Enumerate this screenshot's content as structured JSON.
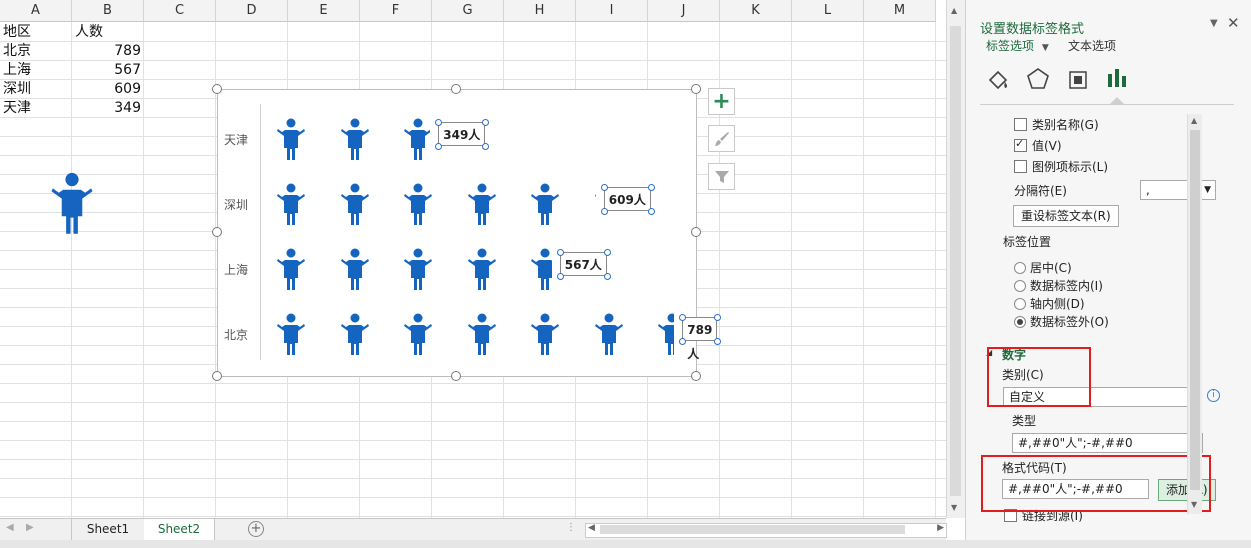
{
  "columns": [
    "A",
    "B",
    "C",
    "D",
    "E",
    "F",
    "G",
    "H",
    "I",
    "J",
    "K",
    "L",
    "M"
  ],
  "table": {
    "header": [
      "地区",
      "人数"
    ],
    "rows": [
      {
        "region": "北京",
        "count": "789"
      },
      {
        "region": "上海",
        "count": "567"
      },
      {
        "region": "深圳",
        "count": "609"
      },
      {
        "region": "天津",
        "count": "349"
      }
    ]
  },
  "chart_data": {
    "type": "bar",
    "orientation": "horizontal",
    "style": "pictograph-person-icons",
    "categories": [
      "天津",
      "深圳",
      "上海",
      "北京"
    ],
    "values": [
      349,
      609,
      567,
      789
    ],
    "data_labels": [
      "349人",
      "609人",
      "567人",
      "789人"
    ],
    "icon_unit": 120,
    "color": "#1565c0",
    "axis_visible": true,
    "grid": false
  },
  "chart_side_buttons": [
    {
      "name": "chart-elements-button",
      "glyph": "+"
    },
    {
      "name": "chart-styles-button",
      "glyph": "✎"
    },
    {
      "name": "chart-filters-button",
      "glyph": "⏷"
    }
  ],
  "sheet_tabs": [
    "Sheet1",
    "Sheet2"
  ],
  "active_tab": "Sheet2",
  "pane": {
    "title": "设置数据标签格式",
    "tab_label_options": "标签选项",
    "tab_text_options": "文本选项",
    "check_category_name": "类别名称(G)",
    "check_value": "值(V)",
    "check_legend_key": "图例项标示(L)",
    "separator_label": "分隔符(E)",
    "separator_value": ",",
    "reset_button": "重设标签文本(R)",
    "position_label": "标签位置",
    "pos_center": "居中(C)",
    "pos_inside_end": "数据标签内(I)",
    "pos_inside_base": "轴内侧(D)",
    "pos_outside_end": "数据标签外(O)",
    "number_section": "数字",
    "category_label": "类别(C)",
    "category_value": "自定义",
    "type_label": "类型",
    "type_value": "#,##0\"人\";-#,##0",
    "format_code_label": "格式代码(T)",
    "format_code_value": "#,##0\"人\";-#,##0",
    "add_button": "添加(A)",
    "link_source": "链接到源(I)"
  },
  "accent_color": "#1d6b3c",
  "highlight_color": "#e01e1e"
}
